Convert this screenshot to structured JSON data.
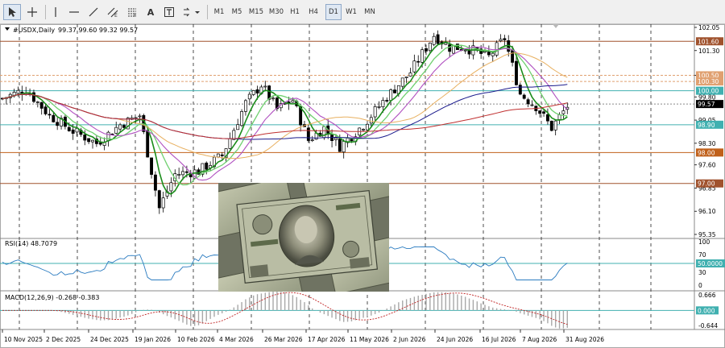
{
  "toolbar": {
    "timeframes": [
      "M1",
      "M5",
      "M15",
      "M30",
      "H1",
      "H4",
      "D1",
      "W1",
      "MN"
    ],
    "active_timeframe": "D1"
  },
  "chart": {
    "title": "#USDX,Daily",
    "ohlc": "99.37 99.60 99.32 99.57",
    "price_ticks": [
      "102.05",
      "101.30",
      "100.50",
      "99.80",
      "99.05",
      "98.30",
      "97.60",
      "96.85",
      "96.10",
      "95.35"
    ],
    "tags": [
      {
        "text": "101.60",
        "color": "#a0522d",
        "price": 101.6
      },
      {
        "text": "100.50",
        "color": "#e0a070",
        "price": 100.5
      },
      {
        "text": "100.30",
        "color": "#e0a070",
        "price": 100.3
      },
      {
        "text": "100.00",
        "color": "#40b0b0",
        "price": 100.0
      },
      {
        "text": "99.57",
        "color": "#000000",
        "price": 99.57
      },
      {
        "text": "98.90",
        "color": "#40b0b0",
        "price": 98.9
      },
      {
        "text": "98.00",
        "color": "#c0601a",
        "price": 98.0
      },
      {
        "text": "97.00",
        "color": "#a0522d",
        "price": 97.0
      }
    ],
    "dates": [
      "10 Nov 2025",
      "2 Dec 2025",
      "24 Dec 2025",
      "19 Jan 2026",
      "10 Feb 2026",
      "4 Mar 2026",
      "26 Mar 2026",
      "17 Apr 2026",
      "11 May 2026",
      "2 Jun 2026",
      "24 Jun 2026",
      "16 Jul 2026",
      "7 Aug 2026",
      "31 Aug 2026"
    ]
  },
  "rsi": {
    "title": "RSI(14) 48.7079",
    "ticks": [
      "100",
      "70",
      "50",
      "30",
      "0"
    ],
    "level_tag": "50.0000"
  },
  "macd": {
    "title": "MACD(12,26,9) -0.268 -0.383",
    "ticks": [
      "0.666",
      "0.000",
      "-0.644"
    ],
    "zero_tag": "0.000"
  }
}
